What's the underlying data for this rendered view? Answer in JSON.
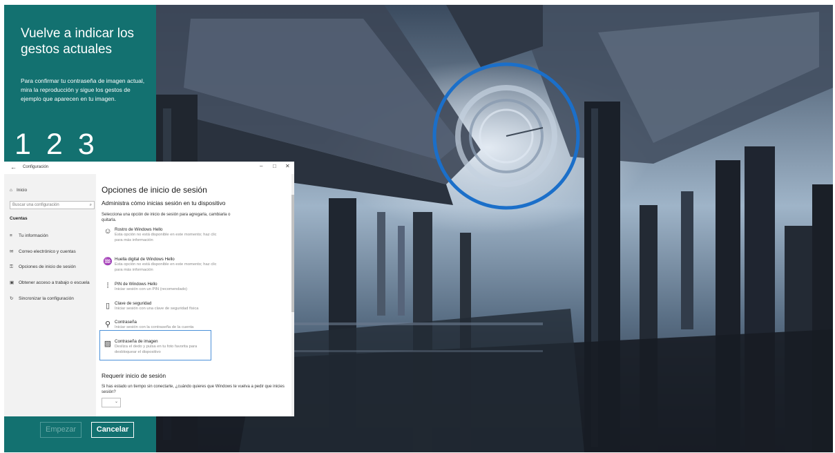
{
  "picture_password": {
    "title": "Vuelve a indicar los gestos actuales",
    "description": "Para confirmar tu contraseña de imagen actual, mira la reproducción y sigue los gestos de ejemplo que aparecen en tu imagen.",
    "steps": [
      "1",
      "2",
      "3"
    ],
    "start_button": "Empezar",
    "cancel_button": "Cancelar",
    "accent_color": "#137170",
    "gesture_color": "#1b6fc9"
  },
  "settings": {
    "window_title": "Configuración",
    "back_icon": "←",
    "controls": {
      "minimize": "–",
      "maximize": "□",
      "close": "✕"
    },
    "nav": {
      "home": "Inicio",
      "search_placeholder": "Buscar una configuración",
      "section": "Cuentas",
      "items": [
        {
          "icon": "person-list-icon",
          "label": "Tu información"
        },
        {
          "icon": "mail-icon",
          "label": "Correo electrónico y cuentas"
        },
        {
          "icon": "key-icon",
          "label": "Opciones de inicio de sesión"
        },
        {
          "icon": "briefcase-icon",
          "label": "Obtener acceso a trabajo o escuela"
        },
        {
          "icon": "sync-icon",
          "label": "Sincronizar la configuración"
        }
      ]
    },
    "page_title": "Opciones de inicio de sesión",
    "subtitle": "Administra cómo inicias sesión en tu dispositivo",
    "intro": "Selecciona una opción de inicio de sesión para agregarla, cambiarla o quitarla.",
    "options": [
      {
        "icon": "face-icon",
        "title": "Rostro de Windows Hello",
        "desc": "Esta opción no está disponible en este momento; haz clic para más información"
      },
      {
        "icon": "fingerprint-icon",
        "title": "Huella digital de Windows Hello",
        "desc": "Esta opción no está disponible en este momento; haz clic para más información"
      },
      {
        "icon": "pin-keypad-icon",
        "title": "PIN de Windows Hello",
        "desc": "Iniciar sesión con un PIN (recomendado)"
      },
      {
        "icon": "security-key-icon",
        "title": "Clave de seguridad",
        "desc": "Iniciar sesión con una clave de seguridad física"
      },
      {
        "icon": "password-key-icon",
        "title": "Contraseña",
        "desc": "Iniciar sesión con la contraseña de la cuenta"
      },
      {
        "icon": "picture-icon",
        "title": "Contraseña de imagen",
        "desc": "Desliza el dedo y pulsa en tu foto favorita para desbloquear el dispositivo"
      }
    ],
    "require_title": "Requerir inicio de sesión",
    "require_text": "Si has estado un tiempo sin conectarte, ¿cuándo quieres que Windows te vuelva a pedir que inicies sesión?",
    "dropdown_value": ""
  }
}
